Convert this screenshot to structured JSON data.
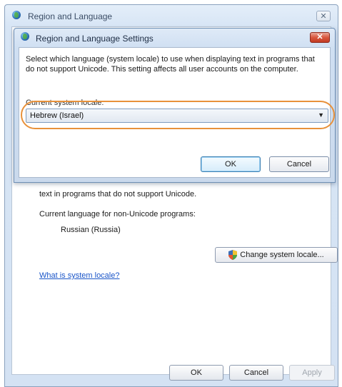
{
  "outer_window": {
    "title": "Region and Language",
    "close_glyph": "✕",
    "description_tail": "text in programs that do not support Unicode.",
    "current_label": "Current language for non-Unicode programs:",
    "current_value": "Russian (Russia)",
    "change_button": "Change system locale...",
    "link": "What is system locale?",
    "buttons": {
      "ok": "OK",
      "cancel": "Cancel",
      "apply": "Apply"
    }
  },
  "dialog": {
    "title": "Region and Language Settings",
    "close_glyph": "✕",
    "description": "Select which language (system locale) to use when displaying text in programs that do not support Unicode. This setting affects all user accounts on the computer.",
    "locale_label": "Current system locale:",
    "locale_value": "Hebrew (Israel)",
    "arrow_glyph": "▼",
    "buttons": {
      "ok": "OK",
      "cancel": "Cancel"
    }
  },
  "icons": {
    "window_icon": "globe-icon",
    "shield": "shield-icon"
  },
  "colors": {
    "highlight": "#e8913a",
    "link": "#1a55c8",
    "close_red": "#c23a22"
  }
}
